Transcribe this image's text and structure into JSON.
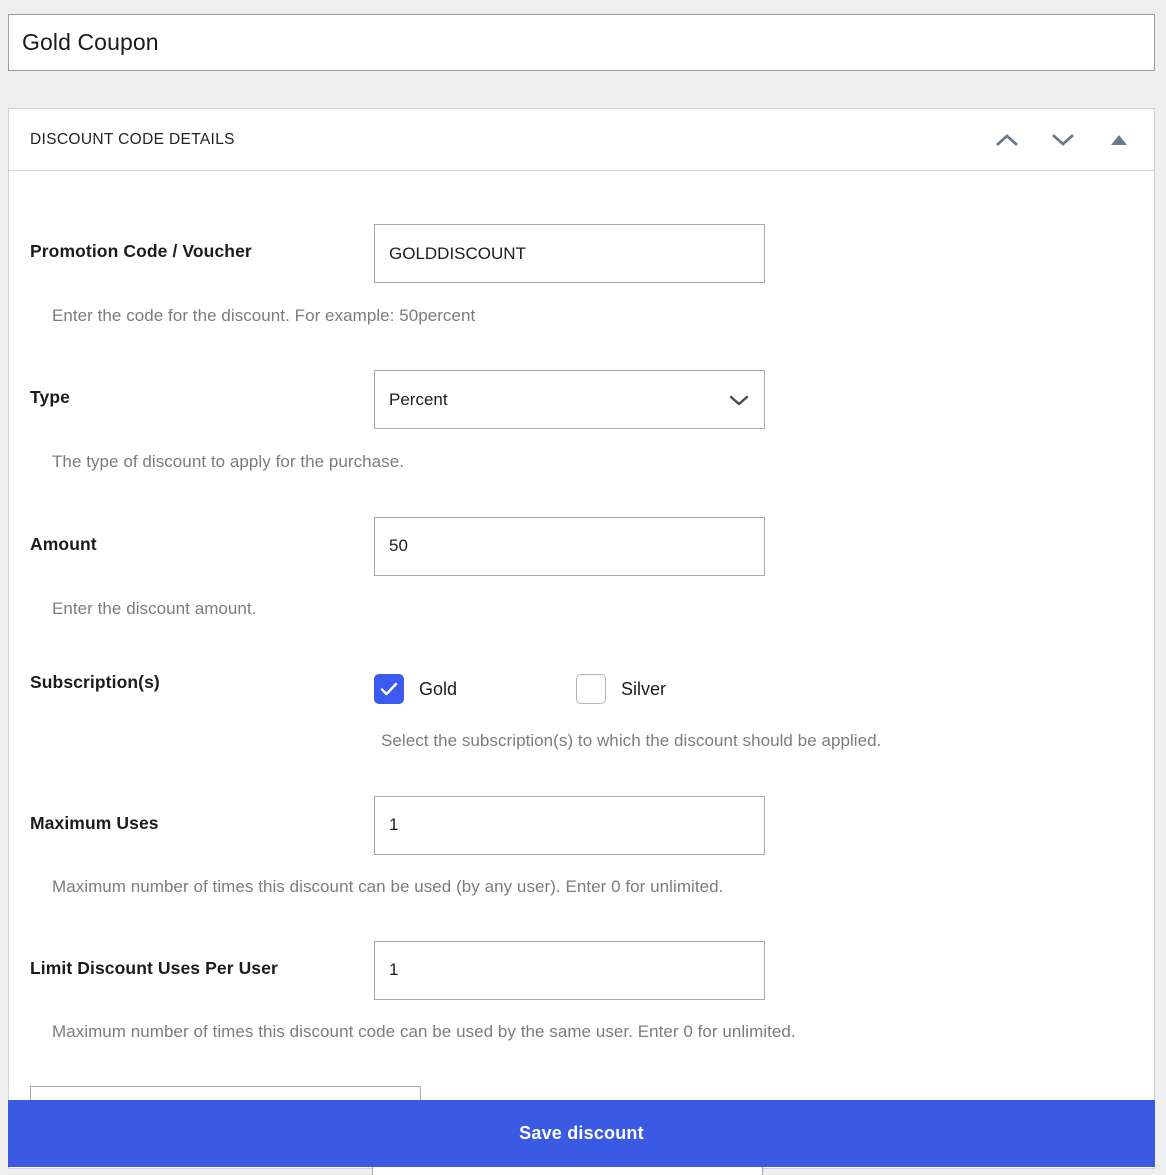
{
  "page": {
    "background_color": "#efefef",
    "accent_color": "#3a5ae4",
    "checkbox_checked_color": "#3b5bf0"
  },
  "title_field": {
    "value": "Gold Coupon"
  },
  "panel": {
    "header_title": "DISCOUNT CODE DETAILS",
    "icons": [
      {
        "name": "chevron-up-icon",
        "glyph": "chevron-up"
      },
      {
        "name": "chevron-down-icon",
        "glyph": "chevron-down"
      },
      {
        "name": "collapse-triangle-icon",
        "glyph": "triangle-up"
      }
    ]
  },
  "fields": {
    "promotion_code": {
      "label": "Promotion Code / Voucher",
      "value": "GOLDDISCOUNT",
      "help": "Enter the code for the discount. For example: 50percent"
    },
    "type": {
      "label": "Type",
      "value": "Percent",
      "options": [
        "Percent"
      ],
      "help": "The type of discount to apply for the purchase."
    },
    "amount": {
      "label": "Amount",
      "value": "50",
      "help": "Enter the discount amount."
    },
    "subscriptions": {
      "label": "Subscription(s)",
      "help": "Select the subscription(s) to which the discount should be applied.",
      "options": [
        {
          "label": "Gold",
          "checked": true
        },
        {
          "label": "Silver",
          "checked": false
        }
      ]
    },
    "maximum_uses": {
      "label": "Maximum Uses",
      "value": "1",
      "help": "Maximum number of times this discount can be used (by any user). Enter 0 for unlimited."
    },
    "limit_per_user": {
      "label": "Limit Discount Uses Per User",
      "value": "1",
      "help": "Maximum number of times this discount code can be used by the same user. Enter 0 for unlimited."
    }
  },
  "save_bar": {
    "label": "Save discount"
  }
}
